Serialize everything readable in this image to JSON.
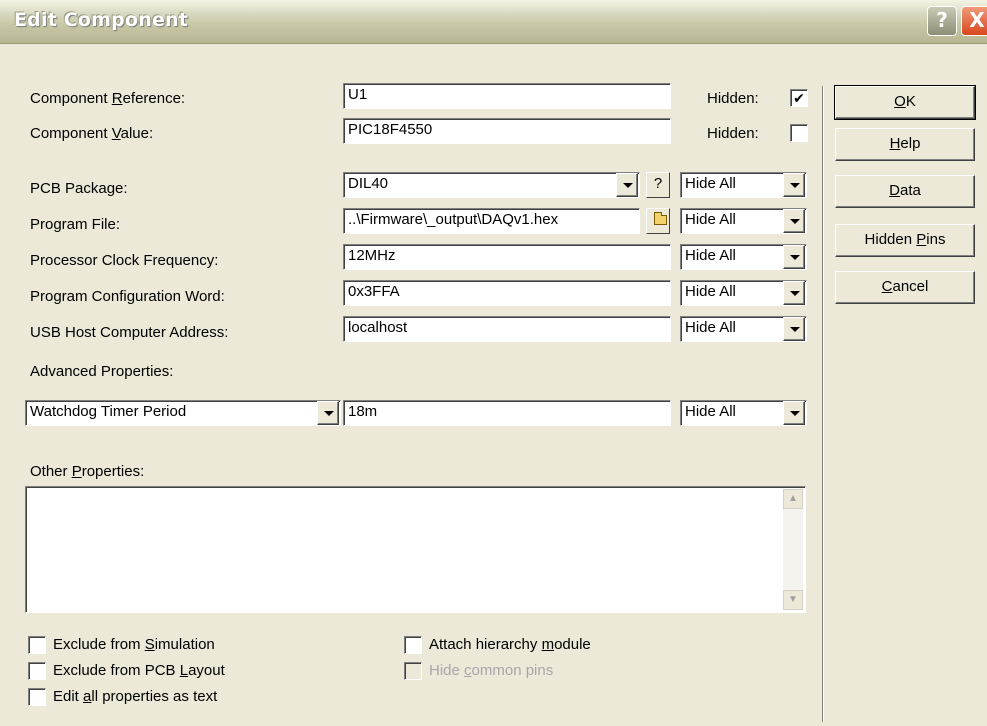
{
  "window": {
    "title": "Edit Component",
    "help_glyph": "?",
    "close_glyph": "X"
  },
  "fields": {
    "component_reference": {
      "label_pre": "Component ",
      "label_key": "R",
      "label_post": "eference:",
      "value": "U1",
      "hidden_label": "Hidden:",
      "hidden_checked": true,
      "check_glyph": "✔"
    },
    "component_value": {
      "label_pre": "Component ",
      "label_key": "V",
      "label_post": "alue:",
      "value": "PIC18F4550",
      "hidden_label": "Hidden:",
      "hidden_checked": false
    },
    "pcb_package": {
      "label": "PCB Package:",
      "value": "DIL40",
      "help_glyph": "?",
      "visibility": "Hide All"
    },
    "program_file": {
      "label": "Program File:",
      "value": "..\\Firmware\\_output\\DAQv1.hex",
      "visibility": "Hide All"
    },
    "clock_frequency": {
      "label": "Processor Clock Frequency:",
      "value": "12MHz",
      "visibility": "Hide All"
    },
    "config_word": {
      "label": "Program Configuration Word:",
      "value": "0x3FFA",
      "visibility": "Hide All"
    },
    "usb_host": {
      "label": "USB Host Computer Address:",
      "value": "localhost",
      "visibility": "Hide All"
    }
  },
  "advanced": {
    "label": "Advanced Properties:",
    "property": "Watchdog Timer Period",
    "value": "18m",
    "visibility": "Hide All"
  },
  "other_properties": {
    "label_pre": "Other ",
    "label_key": "P",
    "label_post": "roperties:",
    "value": ""
  },
  "options": {
    "exclude_simulation": {
      "pre": "Exclude from ",
      "key": "S",
      "post": "imulation",
      "checked": false
    },
    "exclude_pcb": {
      "pre": "Exclude from PCB ",
      "key": "L",
      "post": "ayout",
      "checked": false
    },
    "edit_as_text": {
      "pre": "Edit ",
      "key": "a",
      "post": "ll properties as text",
      "checked": false
    },
    "attach_hierarchy": {
      "pre": "Attach hierarchy ",
      "key": "m",
      "post": "odule",
      "checked": false
    },
    "hide_common_pins": {
      "pre": "Hide ",
      "key": "c",
      "post": "ommon pins",
      "checked": false,
      "disabled": true
    }
  },
  "buttons": {
    "ok": {
      "key": "O",
      "post": "K"
    },
    "help": {
      "key": "H",
      "post": "elp"
    },
    "data": {
      "key": "D",
      "post": "ata"
    },
    "hidden_pins": {
      "pre": "Hidden ",
      "key": "P",
      "post": "ins"
    },
    "cancel": {
      "key": "C",
      "post": "ancel"
    }
  },
  "scroll": {
    "up": "▲",
    "down": "▼"
  }
}
